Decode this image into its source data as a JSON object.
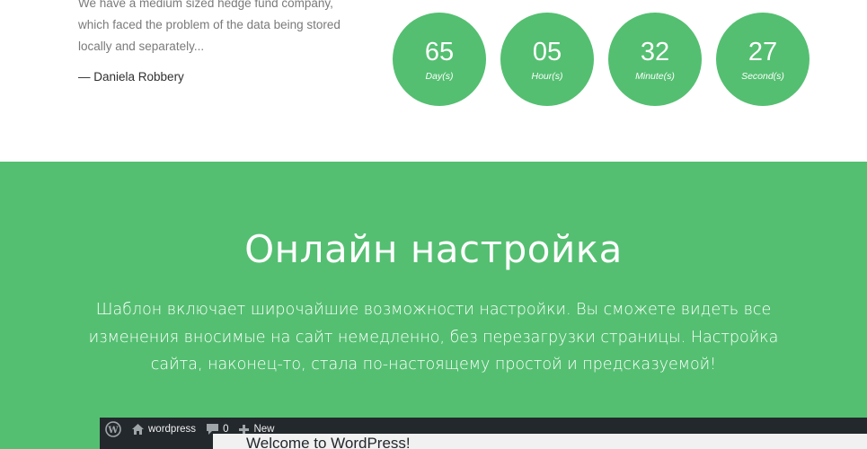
{
  "testimonial": {
    "text": "We have a medium sized hedge fund company, which faced the problem of the data being stored locally and separately...",
    "author": "— Daniela Robbery"
  },
  "countdown": [
    {
      "value": "65",
      "label": "Day(s)"
    },
    {
      "value": "05",
      "label": "Hour(s)"
    },
    {
      "value": "32",
      "label": "Minute(s)"
    },
    {
      "value": "27",
      "label": "Second(s)"
    }
  ],
  "section": {
    "title": "Онлайн настройка",
    "description": "Шаблон включает широчайшие возможности настройки. Вы сможете видеть все изменения вносимые на сайт немедленно, без перезагрузки страницы. Настройка сайта, наконец-то, стала по-настоящему простой и предсказуемой!"
  },
  "wp_admin": {
    "site_name": "wordpress",
    "comments_count": "0",
    "new_label": "New",
    "welcome": "Welcome to WordPress!"
  },
  "colors": {
    "accent": "#54bf71",
    "admin_bar": "#23282d"
  }
}
